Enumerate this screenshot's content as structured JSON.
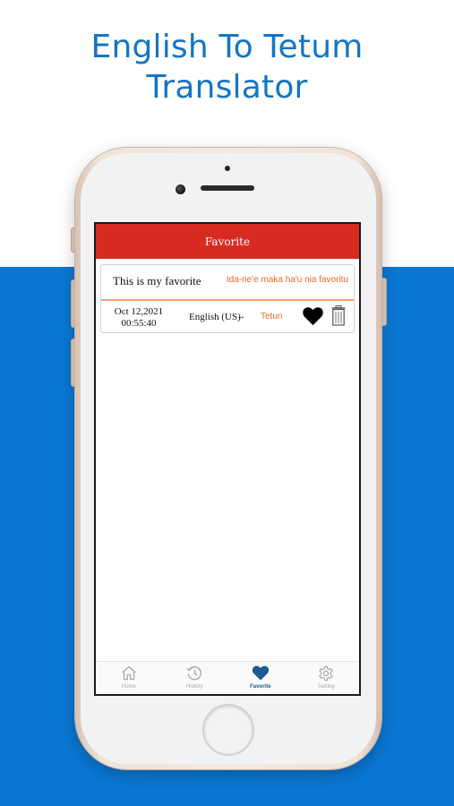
{
  "promo": {
    "headline_line1": "English To Tetum",
    "headline_line2": "Translator"
  },
  "colors": {
    "header_red": "#d72b22",
    "accent_orange": "#f06a28",
    "background_blue": "#0a77d3",
    "active_tab": "#1e5a8e"
  },
  "screen": {
    "title": "Favorite",
    "favorites": [
      {
        "source_text": "This is my favorite",
        "translated_text": "Ida-ne'e maka ha'u nia favoritu",
        "date": "Oct 12,2021",
        "time": "00:55:40",
        "from_language": "English (US)",
        "arrow": "→",
        "to_language": "Tetun",
        "favorite_icon": "heart-filled-icon",
        "delete_icon": "trash-icon"
      }
    ]
  },
  "tabbar": {
    "tabs": [
      {
        "label": "Home",
        "icon": "home-icon",
        "active": false
      },
      {
        "label": "History",
        "icon": "history-icon",
        "active": false
      },
      {
        "label": "Favorite",
        "icon": "heart-icon",
        "active": true
      },
      {
        "label": "Setting",
        "icon": "gear-icon",
        "active": false
      }
    ]
  }
}
